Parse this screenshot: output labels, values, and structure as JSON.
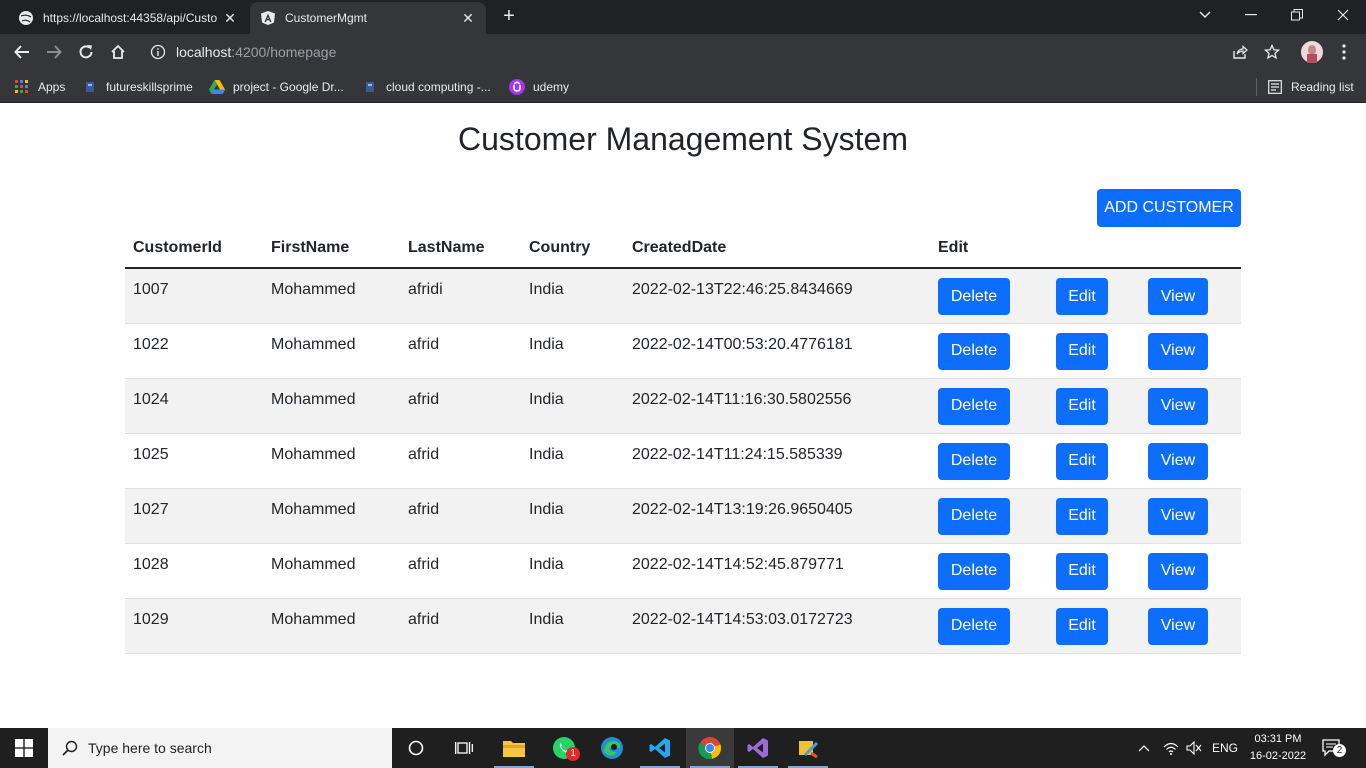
{
  "browser": {
    "tabs": [
      {
        "title": "https://localhost:44358/api/Custo",
        "active": false
      },
      {
        "title": "CustomerMgmt",
        "active": true
      }
    ],
    "address": {
      "host": "localhost",
      "path": ":4200/homepage"
    },
    "bookmarks": [
      "Apps",
      "futureskillsprime",
      "project - Google Dr...",
      "cloud computing -...",
      "udemy"
    ],
    "reading_list": "Reading list"
  },
  "page": {
    "title": "Customer Management System",
    "add_button": "ADD CUSTOMER",
    "columns": [
      "CustomerId",
      "FirstName",
      "LastName",
      "Country",
      "CreatedDate",
      "Edit"
    ],
    "buttons": {
      "delete": "Delete",
      "edit": "Edit",
      "view": "View"
    },
    "rows": [
      {
        "id": "1007",
        "first": "Mohammed",
        "last": "afridi",
        "country": "India",
        "created": "2022-02-13T22:46:25.8434669"
      },
      {
        "id": "1022",
        "first": "Mohammed",
        "last": "afrid",
        "country": "India",
        "created": "2022-02-14T00:53:20.4776181"
      },
      {
        "id": "1024",
        "first": "Mohammed",
        "last": "afrid",
        "country": "India",
        "created": "2022-02-14T11:16:30.5802556"
      },
      {
        "id": "1025",
        "first": "Mohammed",
        "last": "afrid",
        "country": "India",
        "created": "2022-02-14T11:24:15.585339"
      },
      {
        "id": "1027",
        "first": "Mohammed",
        "last": "afrid",
        "country": "India",
        "created": "2022-02-14T13:19:26.9650405"
      },
      {
        "id": "1028",
        "first": "Mohammed",
        "last": "afrid",
        "country": "India",
        "created": "2022-02-14T14:52:45.879771"
      },
      {
        "id": "1029",
        "first": "Mohammed",
        "last": "afrid",
        "country": "India",
        "created": "2022-02-14T14:53:03.0172723"
      }
    ]
  },
  "taskbar": {
    "search_placeholder": "Type here to search",
    "language": "ENG",
    "time": "03:31 PM",
    "date": "16-02-2022",
    "whatsapp_badge": "1",
    "notification_count": "2"
  },
  "colors": {
    "accent": "#0d6efd",
    "chrome_dark": "#202124",
    "chrome_toolbar": "#35363a",
    "taskbar": "#1f1f1f"
  }
}
